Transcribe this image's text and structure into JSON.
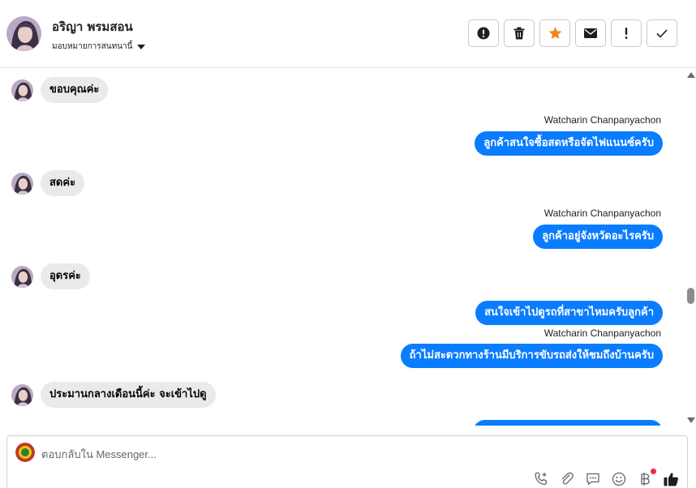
{
  "header": {
    "contact_name": "อริญา พรมสอน",
    "assign_label": "มอบหมายการสนทนานี้"
  },
  "actions": [
    {
      "name": "mark-spam-button",
      "icon": "alert-circle-icon"
    },
    {
      "name": "delete-button",
      "icon": "trash-icon"
    },
    {
      "name": "star-button",
      "icon": "star-icon"
    },
    {
      "name": "mark-unread-button",
      "icon": "envelope-icon"
    },
    {
      "name": "follow-up-button",
      "icon": "exclamation-icon"
    },
    {
      "name": "mark-done-button",
      "icon": "check-icon"
    }
  ],
  "messages": [
    {
      "dir": "in",
      "text": "ขอบคุณค่ะ"
    },
    {
      "dir": "out",
      "sender": "Watcharin Chanpanyachon",
      "text": "ลูกค้าสนใจซื้อสดหรือจัดไฟแนนซ์ครับ"
    },
    {
      "dir": "in",
      "text": "สดค่ะ"
    },
    {
      "dir": "out",
      "sender": "Watcharin Chanpanyachon",
      "text": "ลูกค้าอยู่จังหวัดอะไรครับ"
    },
    {
      "dir": "in",
      "text": "อุดรค่ะ"
    },
    {
      "dir": "out",
      "text": "สนใจเข้าไปดูรถที่สาขาไหมครับลูกค้า"
    },
    {
      "dir": "out",
      "sender": "Watcharin Chanpanyachon",
      "text": "ถ้าไม่สะดวกทางร้านมีบริการขับรถส่งให้ชมถึงบ้านครับ"
    },
    {
      "dir": "in",
      "text": "ประมานกลางเดือนนี้ค่ะ จะเข้าไปดู"
    }
  ],
  "composer": {
    "placeholder": "ตอบกลับใน Messenger..."
  },
  "colors": {
    "outgoing_bubble": "#0a7cff",
    "incoming_bubble": "#e9eaec",
    "star": "#f5821f"
  }
}
